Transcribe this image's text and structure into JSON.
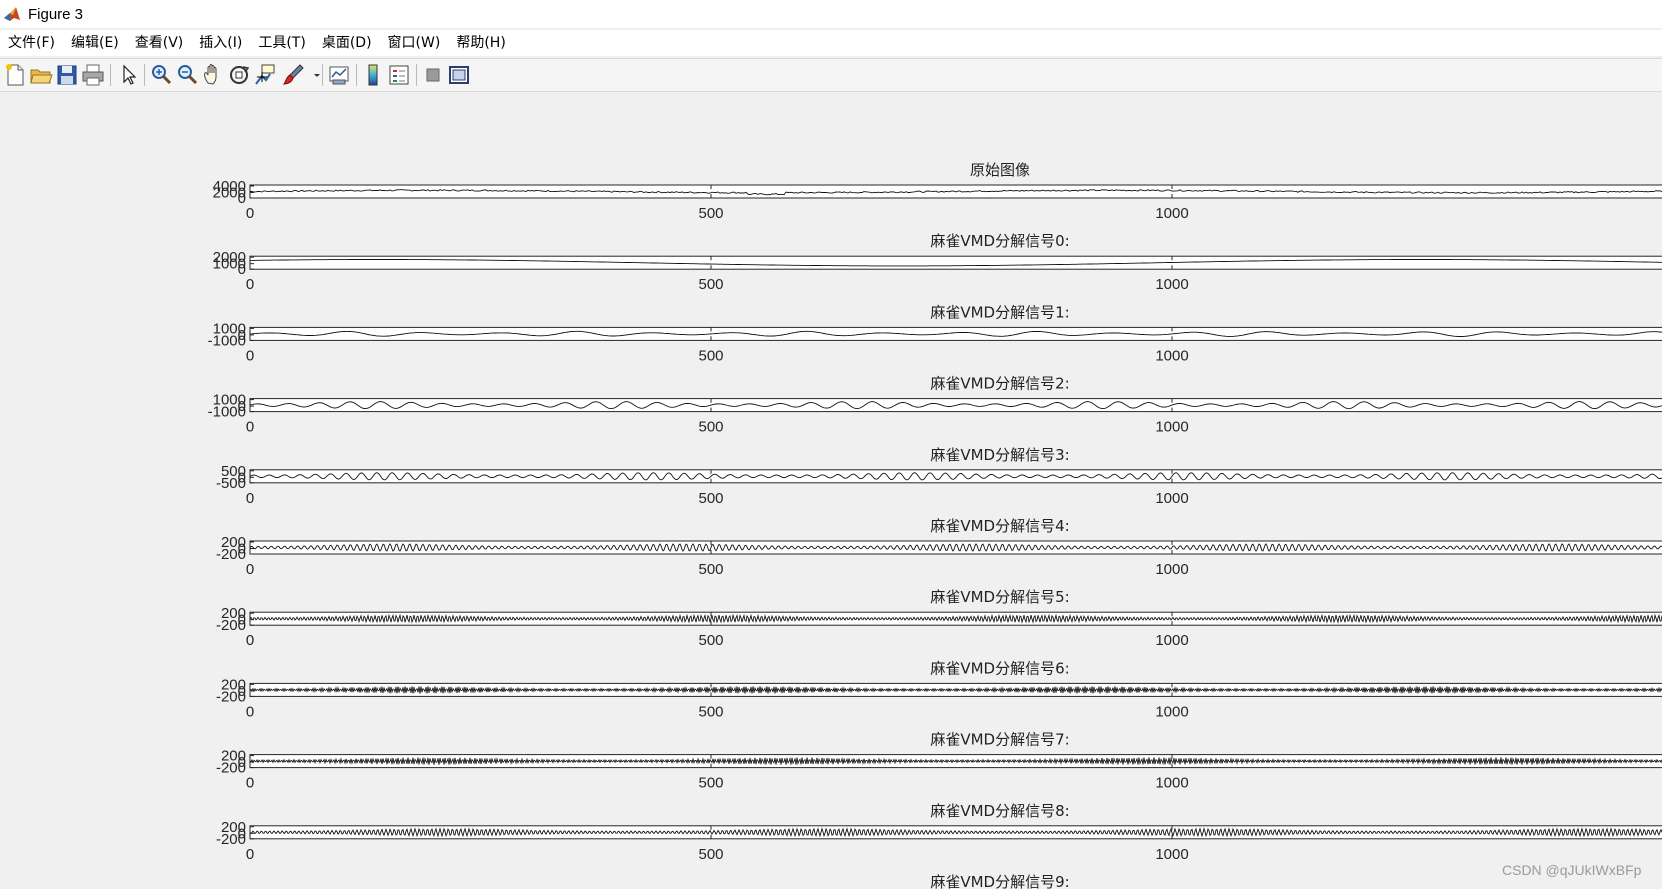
{
  "window": {
    "title": "Figure 3",
    "watermark": "CSDN @qJUkIWxBFp"
  },
  "menu": [
    {
      "label": "文件(F)"
    },
    {
      "label": "编辑(E)"
    },
    {
      "label": "查看(V)"
    },
    {
      "label": "插入(I)"
    },
    {
      "label": "工具(T)"
    },
    {
      "label": "桌面(D)"
    },
    {
      "label": "窗口(W)"
    },
    {
      "label": "帮助(H)"
    }
  ],
  "toolbar": [
    {
      "icon": "new-figure-icon"
    },
    {
      "icon": "open-file-icon"
    },
    {
      "icon": "save-icon"
    },
    {
      "icon": "print-icon"
    },
    {
      "icon": "edit-plot-arrow-icon"
    },
    {
      "icon": "zoom-in-icon"
    },
    {
      "icon": "zoom-out-icon"
    },
    {
      "icon": "pan-hand-icon"
    },
    {
      "icon": "rotate-3d-icon"
    },
    {
      "icon": "data-cursor-icon"
    },
    {
      "icon": "brush-icon"
    },
    {
      "icon": "brush-dropdown-icon"
    },
    {
      "icon": "link-plot-icon"
    },
    {
      "icon": "colorbar-icon"
    },
    {
      "icon": "legend-icon"
    },
    {
      "icon": "hide-plot-tools-icon"
    },
    {
      "icon": "show-plot-tools-icon"
    }
  ],
  "chart_data": {
    "type": "line",
    "x_ticks": [
      0,
      500,
      1000
    ],
    "xlim": [
      0,
      1400
    ],
    "series": [
      {
        "title": "原始图像",
        "yticks": [
          "4000",
          "2000",
          "0"
        ],
        "ylim": [
          0,
          4000
        ]
      },
      {
        "title": "麻雀VMD分解信号0:",
        "yticks": [
          "2000",
          "1000",
          "0"
        ],
        "ylim": [
          0,
          2000
        ]
      },
      {
        "title": "麻雀VMD分解信号1:",
        "yticks": [
          "1000",
          "0",
          "-1000"
        ],
        "ylim": [
          -1000,
          1000
        ]
      },
      {
        "title": "麻雀VMD分解信号2:",
        "yticks": [
          "1000",
          "0",
          "-1000"
        ],
        "ylim": [
          -1000,
          1000
        ]
      },
      {
        "title": "麻雀VMD分解信号3:",
        "yticks": [
          "500",
          "0",
          "-500"
        ],
        "ylim": [
          -500,
          500
        ]
      },
      {
        "title": "麻雀VMD分解信号4:",
        "yticks": [
          "200",
          "0",
          "-200"
        ],
        "ylim": [
          -200,
          200
        ]
      },
      {
        "title": "麻雀VMD分解信号5:",
        "yticks": [
          "200",
          "0",
          "-200"
        ],
        "ylim": [
          -200,
          200
        ]
      },
      {
        "title": "麻雀VMD分解信号6:",
        "yticks": [
          "200",
          "0",
          "-200"
        ],
        "ylim": [
          -200,
          200
        ]
      },
      {
        "title": "麻雀VMD分解信号7:",
        "yticks": [
          "200",
          "0",
          "-200"
        ],
        "ylim": [
          -200,
          200
        ]
      },
      {
        "title": "麻雀VMD分解信号8:",
        "yticks": [
          "200",
          "0",
          "-200"
        ],
        "ylim": [
          -200,
          200
        ]
      },
      {
        "title": "麻雀VMD分解信号9:",
        "yticks": [],
        "ylim": [
          -200,
          200
        ]
      }
    ]
  }
}
